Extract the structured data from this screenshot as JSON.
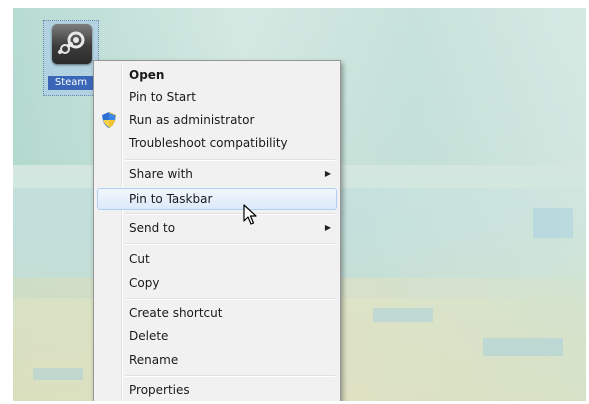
{
  "desktop": {
    "icon": {
      "label": "Steam",
      "icon_name": "steam-logo-icon"
    }
  },
  "context_menu": {
    "items": [
      {
        "label": "Open",
        "bold": true
      },
      {
        "label": "Pin to Start"
      },
      {
        "label": "Run as administrator",
        "icon": "uac-shield-icon"
      },
      {
        "label": "Troubleshoot compatibility"
      },
      {
        "label": "Share with",
        "submenu": true,
        "arrow": "▶"
      },
      {
        "label": "Pin to Taskbar",
        "highlighted": true
      },
      {
        "label": "Send to",
        "submenu": true,
        "arrow": "▶"
      },
      {
        "label": "Cut"
      },
      {
        "label": "Copy"
      },
      {
        "label": "Create shortcut"
      },
      {
        "label": "Delete"
      },
      {
        "label": "Rename"
      },
      {
        "label": "Properties"
      }
    ]
  },
  "colors": {
    "selection_blue": "#3a66b8",
    "hover_border": "#aecff7",
    "menu_background": "#f1f1f1"
  }
}
